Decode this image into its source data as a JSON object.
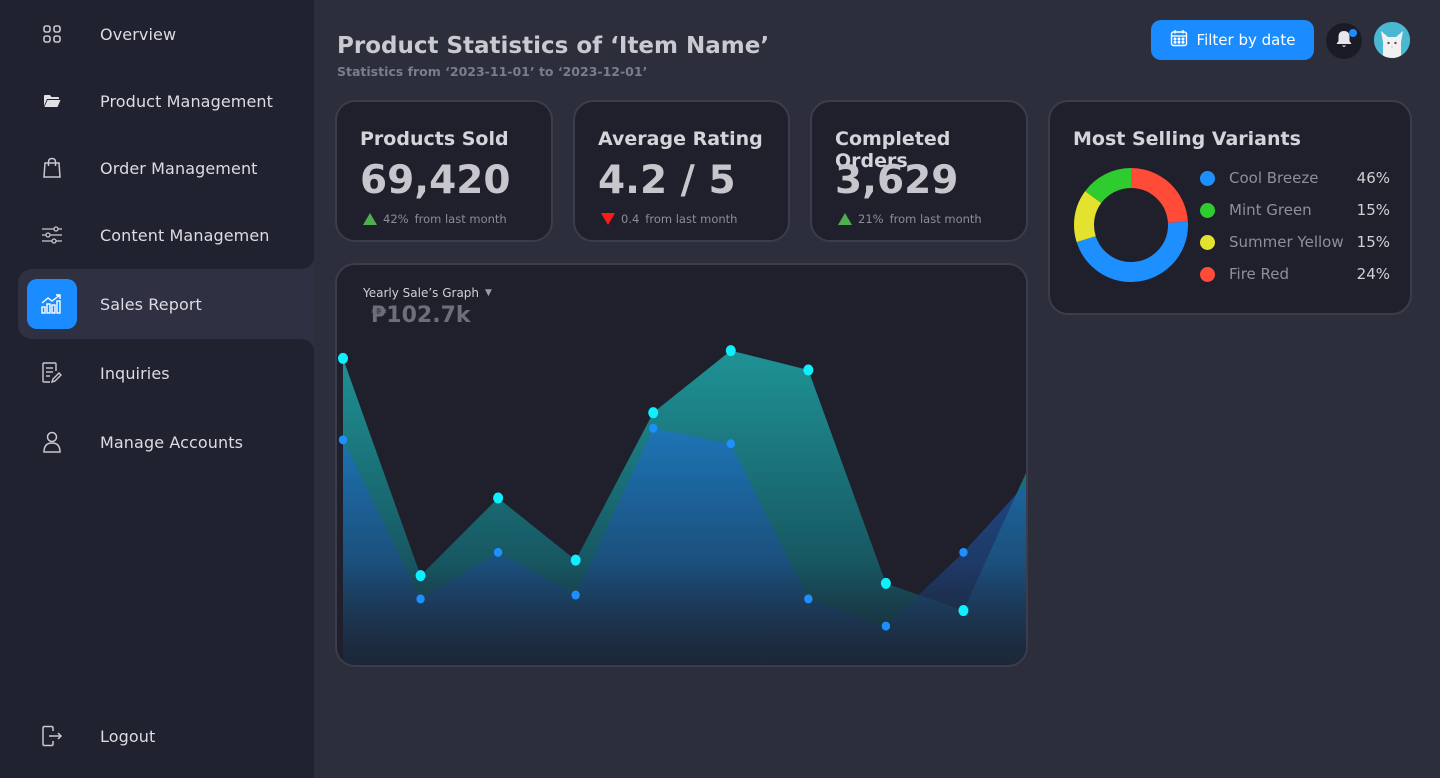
{
  "sidebar": {
    "items": [
      {
        "label": "Overview",
        "icon": "grid-icon"
      },
      {
        "label": "Product Management",
        "icon": "folder-icon"
      },
      {
        "label": "Order Management",
        "icon": "shopping-bag-icon"
      },
      {
        "label": "Content Management",
        "icon": "sliders-icon"
      },
      {
        "label": "Sales Report",
        "icon": "chart-icon",
        "active": true
      },
      {
        "label": "Inquiries",
        "icon": "document-edit-icon"
      },
      {
        "label": "Manage Accounts",
        "icon": "user-icon"
      }
    ],
    "logout": {
      "label": "Logout",
      "icon": "logout-icon"
    }
  },
  "header": {
    "title": "Product Statistics of ‘Item Name’",
    "subtitle": "Statistics from ‘2023-11-01’ to ‘2023-12-01’",
    "filter_label": "Filter by date"
  },
  "stats": [
    {
      "title": "Products Sold",
      "value": "69,420",
      "change": "42%",
      "change_text": "from last month",
      "direction": "up"
    },
    {
      "title": "Average Rating",
      "value": "4.2 / 5",
      "change": "0.4",
      "change_text": "from last month",
      "direction": "down"
    },
    {
      "title": "Completed Orders",
      "value": "3,629",
      "change": "21%",
      "change_text": "from last month",
      "direction": "up"
    }
  ],
  "variants": {
    "title": "Most Selling Variants",
    "items": [
      {
        "name": "Cool Breeze",
        "pct": "46%",
        "color": "#1e8fff"
      },
      {
        "name": "Mint Green",
        "pct": "15%",
        "color": "#2ecc2e"
      },
      {
        "name": "Summer Yellow",
        "pct": "15%",
        "color": "#e3e32f"
      },
      {
        "name": "Fire Red",
        "pct": "24%",
        "color": "#ff4b38"
      }
    ]
  },
  "graph": {
    "label": "Yearly Sale’s Graph",
    "value": "₱102.7k"
  },
  "chart_data": {
    "type": "area",
    "x": [
      0,
      1,
      2,
      3,
      4,
      5,
      6,
      7,
      8,
      9
    ],
    "series": [
      {
        "values": [
          78,
          22,
          42,
          26,
          64,
          80,
          75,
          20,
          13,
          57
        ],
        "color": "#0ff0ff"
      },
      {
        "values": [
          57,
          16,
          28,
          17,
          60,
          56,
          16,
          9,
          28,
          50
        ],
        "color": "#1e8fff"
      }
    ],
    "ylim": [
      0,
      100
    ],
    "grid": false
  },
  "colors": {
    "accent": "#1a8cff",
    "up": "#4fae4f",
    "down": "#ff1a1a"
  }
}
